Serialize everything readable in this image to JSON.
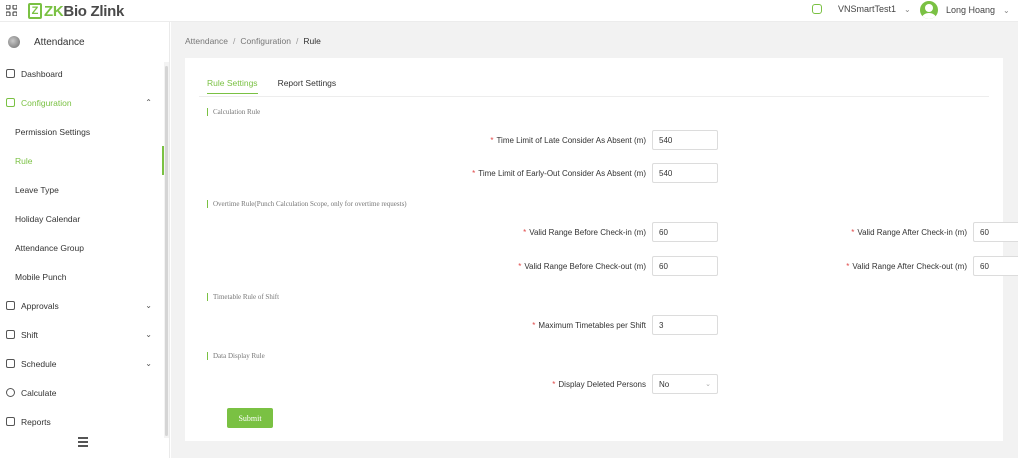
{
  "app": {
    "logo_mark": "Z",
    "logo_brand": "ZK",
    "logo_rest": "Bio Zlink",
    "tenant": "VNSmartTest1",
    "user": "Long Hoang"
  },
  "sidebar": {
    "module": "Attendance",
    "items": [
      {
        "label": "Dashboard"
      },
      {
        "label": "Configuration"
      },
      {
        "label": "Permission Settings"
      },
      {
        "label": "Rule"
      },
      {
        "label": "Leave Type"
      },
      {
        "label": "Holiday Calendar"
      },
      {
        "label": "Attendance Group"
      },
      {
        "label": "Mobile Punch"
      },
      {
        "label": "Approvals"
      },
      {
        "label": "Shift"
      },
      {
        "label": "Schedule"
      },
      {
        "label": "Calculate"
      },
      {
        "label": "Reports"
      }
    ]
  },
  "breadcrumb": [
    "Attendance",
    "Configuration",
    "Rule"
  ],
  "tabs": [
    {
      "label": "Rule Settings",
      "active": true
    },
    {
      "label": "Report Settings",
      "active": false
    }
  ],
  "sections": {
    "calc": "Calculation Rule",
    "overtime": "Overtime Rule(Punch Calculation Scope, only for overtime requests)",
    "timetable": "Timetable Rule of Shift",
    "display": "Data Display Rule"
  },
  "fields": {
    "late_absent": {
      "label": "Time Limit of Late Consider As Absent (m)",
      "value": "540"
    },
    "early_absent": {
      "label": "Time Limit of Early-Out Consider As Absent (m)",
      "value": "540"
    },
    "before_checkin": {
      "label": "Valid Range Before Check-in (m)",
      "value": "60"
    },
    "after_checkin": {
      "label": "Valid Range After Check-in (m)",
      "value": "60"
    },
    "before_checkout": {
      "label": "Valid Range Before Check-out (m)",
      "value": "60"
    },
    "after_checkout": {
      "label": "Valid Range After Check-out (m)",
      "value": "60"
    },
    "max_timetables": {
      "label": "Maximum Timetables per Shift",
      "value": "3"
    },
    "display_deleted": {
      "label": "Display Deleted Persons",
      "value": "No"
    }
  },
  "required_mark": "*",
  "submit_label": "Submit",
  "colors": {
    "accent": "#7ac143",
    "required": "#e04848",
    "background": "#f2f2f2"
  }
}
